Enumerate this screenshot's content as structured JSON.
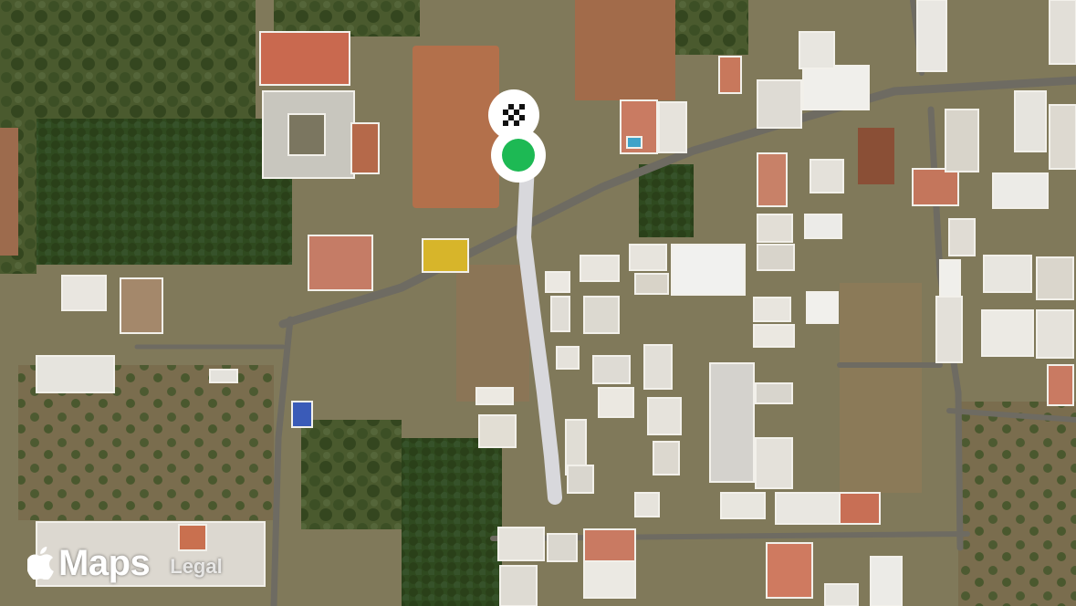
{
  "map": {
    "view": "satellite",
    "route": {
      "color": "#d8d8dc",
      "start_color": "#1db954",
      "finish_icon": "checkered-flag-icon",
      "start_icon": "green-dot-icon"
    }
  },
  "attribution": {
    "logo_icon": "apple-logo-icon",
    "brand": "Maps",
    "legal": "Legal"
  }
}
